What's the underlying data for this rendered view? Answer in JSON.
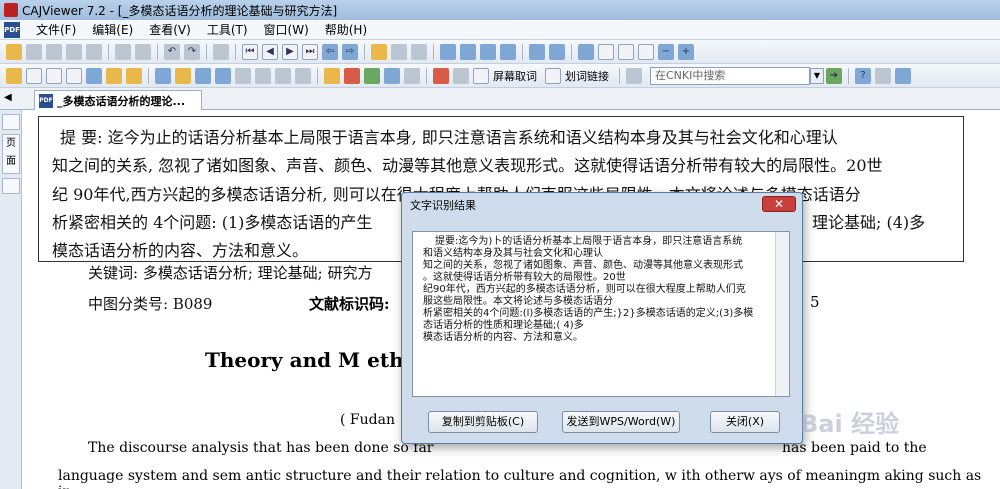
{
  "window": {
    "title": "CAJViewer 7.2 - [_多模态话语分析的理论基础与研究方法]"
  },
  "menu": {
    "items": [
      "文件(F)",
      "编辑(E)",
      "查看(V)",
      "工具(T)",
      "窗口(W)",
      "帮助(H)"
    ]
  },
  "toolbar2": {
    "screen_translate": "屏幕取词",
    "word_link": "划词链接",
    "search_placeholder": "在CNKI中搜索"
  },
  "document_tab": {
    "label": "_多模态话语分析的理论..."
  },
  "sidepanel": {
    "label": "页面"
  },
  "document": {
    "abstract_lines": [
      "提  要: 迄今为止的话语分析基本上局限于语言本身, 即只注意语言系统和语义结构本身及其与社会文化和心理认",
      "知之间的关系, 忽视了诸如图象、声音、颜色、动漫等其他意义表现形式。这就使得话语分析带有较大的局限性。20世",
      "纪 90年代,西方兴起的多模态话语分析, 则可以在很大程度上帮助人们克服这些局限性。本文将论述与多模态话语分",
      "析紧密相关的 4个问题: (1)多模态话语的产生",
      "理论基础; (4)多",
      "模态话语分析的内容、方法和意义。"
    ],
    "keywords": "关键词: 多模态话语分析; 理论基础; 研究方",
    "classification": "中图分类号: B089",
    "doc_code_label": "文献标识码:",
    "issue_fragment": "5",
    "english_title": "Theory and M ethoo",
    "english_affiliation": "( Fudan",
    "english_abstract_1": "The  discourse  analysis  that has  been  done  so  far",
    "english_abstract_1b": "has been paid to the",
    "english_abstract_2": "language system and sem antic structure and their relation to culture and cognition,  w ith otherw ays of meaningm aking such as in-"
  },
  "dialog": {
    "title": "文字识别结果",
    "close_symbol": "✕",
    "text_lines": [
      "提要:迄今为)卜的话语分析基本上局限于语言本身，即只注意语言系统",
      "和语义结构本身及其与社会文化和心理认",
      "知之间的关系，忽视了诸如图象、声音、颜色、动漫等其他意义表现形式",
      "。这就使得话语分析带有较大的局限性。20世",
      "纪90年代，西方兴起的多模态话语分析，则可以在很大程度上帮助人们克",
      "服这些局限性。本文将论述与多模态话语分",
      "析紧密相关的4个问题:(l)多模态话语的产生;}2}多模态话语的定义;(3)多模",
      "态话语分析的性质和理论基础;( 4)多",
      "模态话语分析的内容、方法和意义。"
    ],
    "buttons": {
      "copy": "复制到剪贴板(C)",
      "send": "发送到WPS/Word(W)",
      "close": "关闭(X)"
    }
  },
  "watermark": {
    "text": "Bai 经验"
  }
}
